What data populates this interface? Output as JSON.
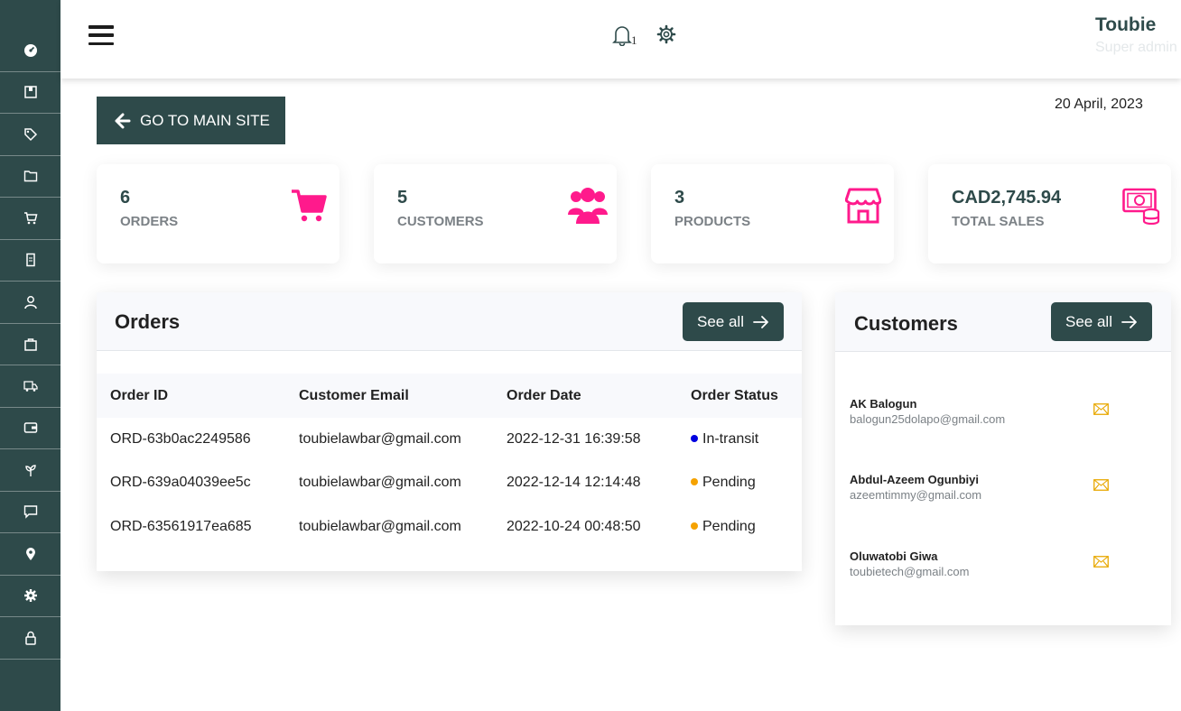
{
  "sidebar": {
    "items": [
      {
        "icon": "dashboard-icon"
      },
      {
        "icon": "box-icon"
      },
      {
        "icon": "tags-icon"
      },
      {
        "icon": "folder-icon"
      },
      {
        "icon": "cart-icon"
      },
      {
        "icon": "document-icon"
      },
      {
        "icon": "user-icon"
      },
      {
        "icon": "bag-icon"
      },
      {
        "icon": "shipping-icon"
      },
      {
        "icon": "wallet-icon"
      },
      {
        "icon": "leaf-icon"
      },
      {
        "icon": "chat-icon"
      },
      {
        "icon": "location-icon"
      },
      {
        "icon": "settings-icon"
      },
      {
        "icon": "lock-icon"
      }
    ],
    "color": "#2e4a4a"
  },
  "header": {
    "notification_count": "1",
    "user_name": "Toubie",
    "user_role": "Super admin"
  },
  "main": {
    "go_main_label": "GO TO MAIN SITE",
    "date": "20 April, 2023"
  },
  "stats": [
    {
      "value": "6",
      "label": "ORDERS",
      "icon": "cart-icon"
    },
    {
      "value": "5",
      "label": "CUSTOMERS",
      "icon": "users-icon"
    },
    {
      "value": "3",
      "label": "PRODUCTS",
      "icon": "store-icon"
    },
    {
      "value": "CAD2,745.94",
      "label": "TOTAL SALES",
      "icon": "money-icon"
    }
  ],
  "orders": {
    "title": "Orders",
    "see_all": "See all",
    "columns": [
      "Order ID",
      "Customer Email",
      "Order Date",
      "Order Status"
    ],
    "rows": [
      {
        "id": "ORD-63b0ac2249586",
        "email": "toubielawbar@gmail.com",
        "date": "2022-12-31 16:39:58",
        "status": "In-transit",
        "status_color": "#0000e0"
      },
      {
        "id": "ORD-639a04039ee5c",
        "email": "toubielawbar@gmail.com",
        "date": "2022-12-14 12:14:48",
        "status": "Pending",
        "status_color": "#f5a200"
      },
      {
        "id": "ORD-63561917ea685",
        "email": "toubielawbar@gmail.com",
        "date": "2022-10-24 00:48:50",
        "status": "Pending",
        "status_color": "#f5a200"
      }
    ]
  },
  "customers": {
    "title": "Customers",
    "see_all": "See all",
    "items": [
      {
        "name": "AK Balogun",
        "email": "balogun25dolapo@gmail.com"
      },
      {
        "name": "Abdul-Azeem Ogunbiyi",
        "email": "azeemtimmy@gmail.com"
      },
      {
        "name": "Oluwatobi Giwa",
        "email": "toubietech@gmail.com"
      }
    ]
  },
  "colors": {
    "accent": "#2e4a4a",
    "pink": "#ff1a8c",
    "mail": "#e8a800"
  }
}
